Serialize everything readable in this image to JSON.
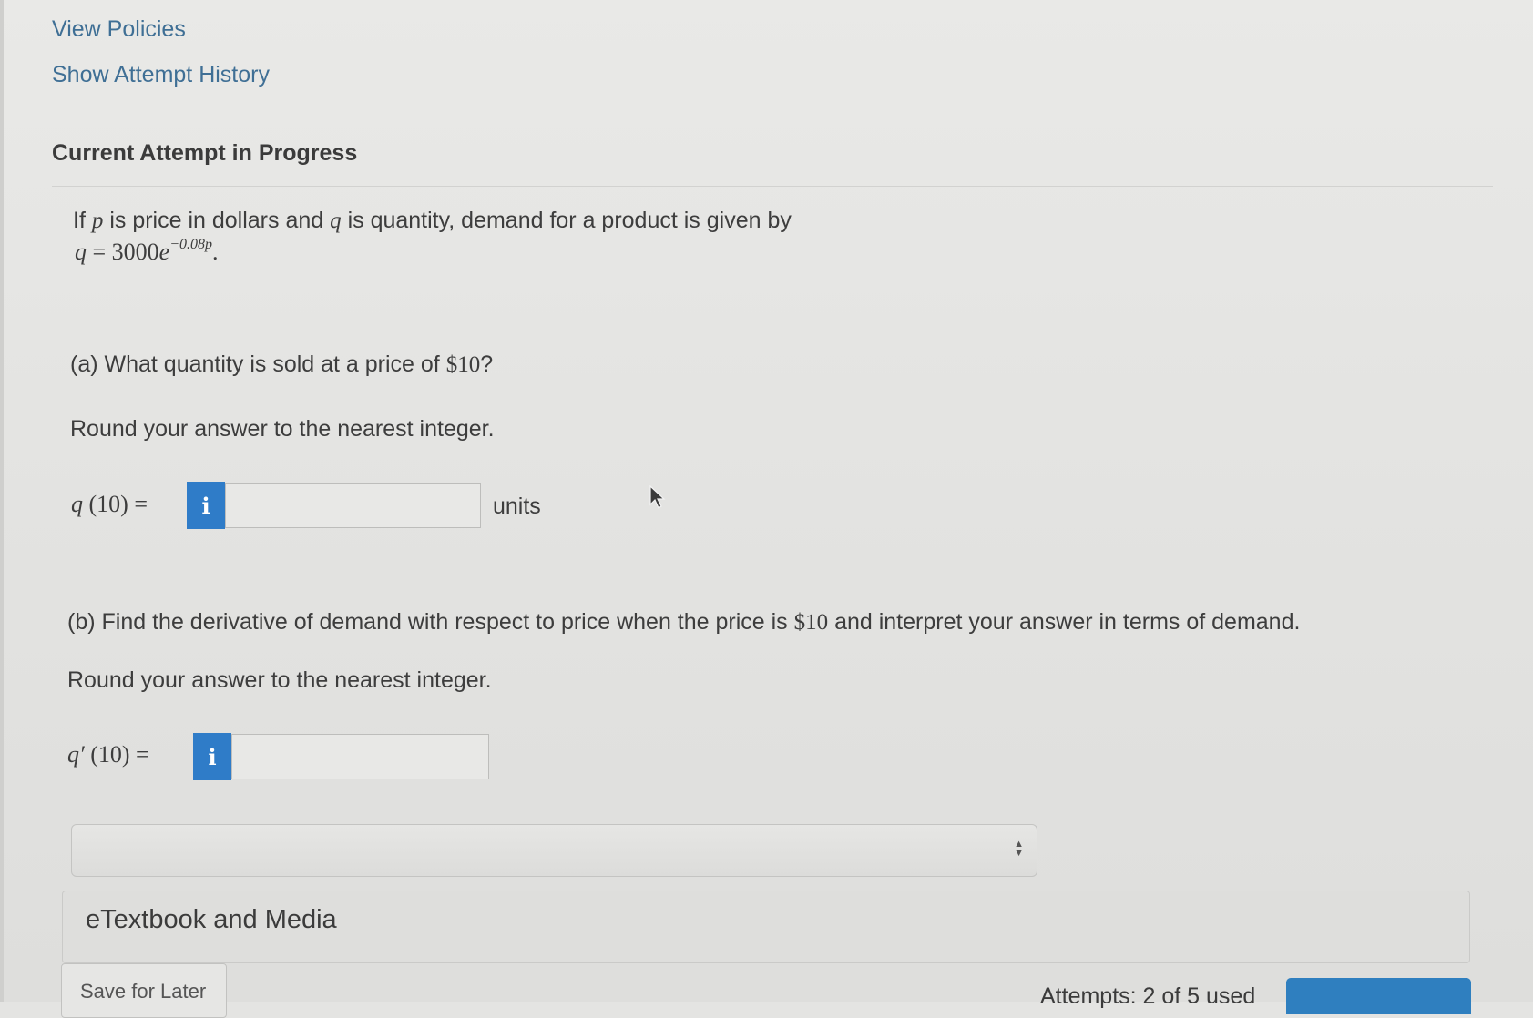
{
  "links": {
    "view_policies": "View Policies",
    "show_attempt_history": "Show Attempt History"
  },
  "section_title": "Current Attempt in Progress",
  "problem": {
    "intro_prefix": "If",
    "var_p": "p",
    "intro_mid": "is price in dollars and",
    "var_q": "q",
    "intro_suffix": "is quantity, demand for a product is given by",
    "equation_lhs": "q",
    "equation_eq": " = 3000",
    "equation_base": "e",
    "equation_exp": "−0.08p",
    "equation_end": "."
  },
  "part_a": {
    "label": "(a)",
    "question_prefix": "What quantity is sold at a price of ",
    "question_price": "$10",
    "question_suffix": "?",
    "round_note": "Round your answer to the nearest integer.",
    "answer_lhs_var": "q",
    "answer_lhs_rest": "(10) =",
    "info_glyph": "i",
    "input_value": "",
    "units": "units"
  },
  "part_b": {
    "label": "(b)",
    "question_prefix": "Find the derivative of demand with respect to price when the price is ",
    "question_price": "$10",
    "question_suffix": " and interpret your answer in terms of demand.",
    "round_note": "Round your answer to the nearest integer.",
    "answer_lhs_var": "q′",
    "answer_lhs_rest": "(10) =",
    "info_glyph": "i",
    "input_value": "",
    "select_value": ""
  },
  "etextbook_label": "eTextbook and Media",
  "footer": {
    "save_label": "Save for Later",
    "attempts_text": "Attempts: 2 of 5 used"
  },
  "colors": {
    "link": "#3f6f95",
    "info_button": "#2f7cc8",
    "submit_button": "#2f7fbf"
  }
}
